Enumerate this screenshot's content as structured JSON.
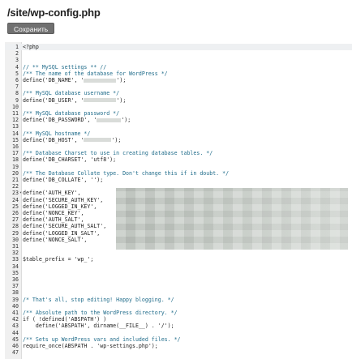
{
  "header": {
    "file_path": "/site/wp-config.php",
    "save_label": "Сохранить"
  },
  "editor": {
    "active_line": 1,
    "fold_markers": [
      23
    ],
    "lines": [
      {
        "n": "1",
        "text": "<?php",
        "cls": ""
      },
      {
        "n": "2",
        "text": "",
        "cls": ""
      },
      {
        "n": "3",
        "text": "",
        "cls": ""
      },
      {
        "n": "4",
        "text": "// ** MySQL settings ** //",
        "cls": "cm"
      },
      {
        "n": "5",
        "text": "/** The name of the database for WordPress */",
        "cls": "cm"
      },
      {
        "n": "6",
        "text": "define('DB_NAME', '",
        "cls": "",
        "redact": 40,
        "tail": "');"
      },
      {
        "n": "7",
        "text": "",
        "cls": ""
      },
      {
        "n": "8",
        "text": "/** MySQL database username */",
        "cls": "cm"
      },
      {
        "n": "9",
        "text": "define('DB_USER', '",
        "cls": "",
        "redact": 40,
        "tail": "');"
      },
      {
        "n": "10",
        "text": "",
        "cls": ""
      },
      {
        "n": "11",
        "text": "/** MySQL database password */",
        "cls": "cm"
      },
      {
        "n": "12",
        "text": "define('DB_PASSWORD', '",
        "cls": "",
        "redact": 30,
        "tail": "');"
      },
      {
        "n": "13",
        "text": "",
        "cls": ""
      },
      {
        "n": "14",
        "text": "/** MySQL hostname */",
        "cls": "cm"
      },
      {
        "n": "15",
        "text": "define('DB_HOST', '",
        "cls": "",
        "redact": 34,
        "tail": "');"
      },
      {
        "n": "16",
        "text": "",
        "cls": ""
      },
      {
        "n": "17",
        "text": "/** Database Charset to use in creating database tables. */",
        "cls": "cm"
      },
      {
        "n": "18",
        "text": "define('DB_CHARSET', 'utf8');",
        "cls": ""
      },
      {
        "n": "19",
        "text": "",
        "cls": ""
      },
      {
        "n": "20",
        "text": "/** The Database Collate type. Don't change this if in doubt. */",
        "cls": "cm"
      },
      {
        "n": "21",
        "text": "define('DB_COLLATE', '');",
        "cls": ""
      },
      {
        "n": "22",
        "text": "",
        "cls": ""
      },
      {
        "n": "23",
        "text": "define('AUTH_KEY',",
        "cls": ""
      },
      {
        "n": "24",
        "text": "define('SECURE_AUTH_KEY',",
        "cls": ""
      },
      {
        "n": "25",
        "text": "define('LOGGED_IN_KEY',",
        "cls": ""
      },
      {
        "n": "26",
        "text": "define('NONCE_KEY',",
        "cls": ""
      },
      {
        "n": "27",
        "text": "define('AUTH_SALT',",
        "cls": ""
      },
      {
        "n": "28",
        "text": "define('SECURE_AUTH_SALT',",
        "cls": ""
      },
      {
        "n": "29",
        "text": "define('LOGGED_IN_SALT',",
        "cls": ""
      },
      {
        "n": "30",
        "text": "define('NONCE_SALT',",
        "cls": ""
      },
      {
        "n": "31",
        "text": "",
        "cls": ""
      },
      {
        "n": "32",
        "text": "",
        "cls": ""
      },
      {
        "n": "33",
        "text": "$table_prefix = 'wp_';",
        "cls": ""
      },
      {
        "n": "34",
        "text": "",
        "cls": ""
      },
      {
        "n": "35",
        "text": "",
        "cls": ""
      },
      {
        "n": "36",
        "text": "",
        "cls": ""
      },
      {
        "n": "37",
        "text": "",
        "cls": ""
      },
      {
        "n": "38",
        "text": "",
        "cls": ""
      },
      {
        "n": "39",
        "text": "/* That's all, stop editing! Happy blogging. */",
        "cls": "cm"
      },
      {
        "n": "40",
        "text": "",
        "cls": ""
      },
      {
        "n": "41",
        "text": "/** Absolute path to the WordPress directory. */",
        "cls": "cm"
      },
      {
        "n": "42",
        "text": "if ( !defined('ABSPATH') )",
        "cls": ""
      },
      {
        "n": "43",
        "text": "    define('ABSPATH', dirname(__FILE__) . '/');",
        "cls": ""
      },
      {
        "n": "44",
        "text": "",
        "cls": ""
      },
      {
        "n": "45",
        "text": "/** Sets up WordPress vars and included files. */",
        "cls": "cm"
      },
      {
        "n": "46",
        "text": "require_once(ABSPATH . 'wp-settings.php');",
        "cls": ""
      },
      {
        "n": "47",
        "text": "",
        "cls": ""
      }
    ]
  }
}
